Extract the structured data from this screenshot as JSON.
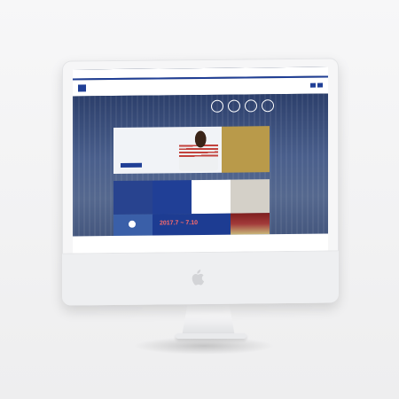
{
  "site": {
    "topbar": {
      "items": [
        "",
        "",
        ""
      ]
    },
    "header": {
      "logo_text": "",
      "nav": [
        "",
        "",
        "",
        "",
        ""
      ]
    },
    "hero": {
      "title_line1": "",
      "title_line2": ""
    },
    "banner": {
      "text_line1": "",
      "text_line2": "",
      "text_line3": "",
      "button": ""
    },
    "gold": {
      "text_line1": "",
      "text_line2": "",
      "text_line3": ""
    },
    "cols": {
      "a_label": "",
      "b_label": "",
      "c_label": "",
      "d_label": ""
    },
    "event": {
      "date": "2017.7 ~ 7.10"
    },
    "footer": {
      "text": ""
    }
  },
  "colors": {
    "primary": "#203f96",
    "accent": "#ff6b6b",
    "gold": "#b99a4a"
  },
  "icons": [
    "apple-logo-icon",
    "play-icon",
    "round-link-icon"
  ]
}
